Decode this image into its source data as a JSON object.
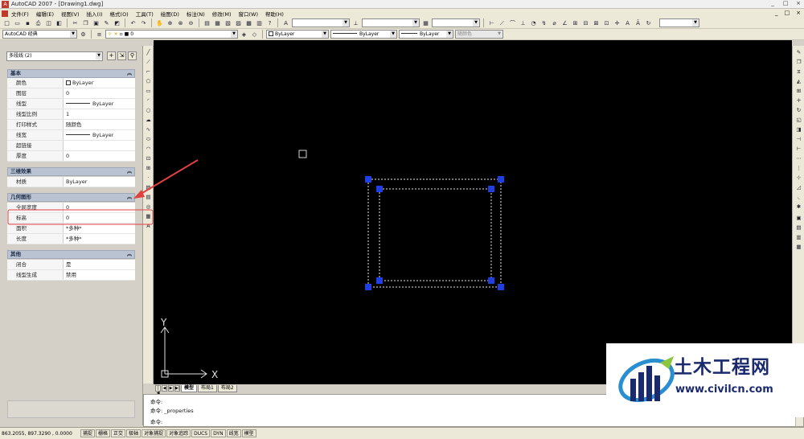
{
  "window": {
    "title": "AutoCAD 2007 - [Drawing1.dwg]",
    "controls": [
      "_",
      "□",
      "×"
    ]
  },
  "menu": {
    "items": [
      "文件(F)",
      "编辑(E)",
      "视图(V)",
      "插入(I)",
      "格式(O)",
      "工具(T)",
      "绘图(D)",
      "标注(N)",
      "修改(M)",
      "窗口(W)",
      "帮助(H)"
    ],
    "doc_controls": [
      "_",
      "□",
      "×"
    ]
  },
  "toolbar2": {
    "workspace": "AutoCAD 经典",
    "layer": "0",
    "color": "ByLayer",
    "linetype": "ByLayer",
    "lineweight": "ByLayer",
    "plotstyle": "随颜色"
  },
  "properties": {
    "selection": "多段线 (2)",
    "categories": {
      "basic": "基本",
      "three_d": "三维效果",
      "geometry": "几何图形",
      "other": "其他"
    },
    "basic_rows": [
      {
        "name": "颜色",
        "value": "ByLayer"
      },
      {
        "name": "图层",
        "value": "0"
      },
      {
        "name": "线型",
        "value": "ByLayer"
      },
      {
        "name": "线型比例",
        "value": "1"
      },
      {
        "name": "打印样式",
        "value": "随颜色"
      },
      {
        "name": "线宽",
        "value": "ByLayer"
      },
      {
        "name": "超链接",
        "value": ""
      },
      {
        "name": "厚度",
        "value": "0"
      }
    ],
    "three_d_rows": [
      {
        "name": "材质",
        "value": "ByLayer"
      }
    ],
    "geometry_rows": [
      {
        "name": "全局宽度",
        "value": "0"
      },
      {
        "name": "标高",
        "value": "0"
      },
      {
        "name": "面积",
        "value": "*多种*"
      },
      {
        "name": "长度",
        "value": "*多种*"
      }
    ],
    "other_rows": [
      {
        "name": "闭合",
        "value": "是"
      },
      {
        "name": "线型生成",
        "value": "禁用"
      }
    ]
  },
  "canvas": {
    "ucs_x": "X",
    "ucs_y": "Y"
  },
  "layout_tabs": [
    "模型",
    "布局1",
    "布局2"
  ],
  "command": {
    "lines": [
      "命令:",
      "命令: _properties",
      "命令:"
    ]
  },
  "status": {
    "coords": "863.2055, 897.3290 , 0.0000",
    "buttons": [
      "捕捉",
      "栅格",
      "正交",
      "极轴",
      "对象捕捉",
      "对象追踪",
      "DUCS",
      "DYN",
      "线宽",
      "模型"
    ]
  },
  "watermark": {
    "text": "土木工程网",
    "url": "www.civilcn.com"
  }
}
